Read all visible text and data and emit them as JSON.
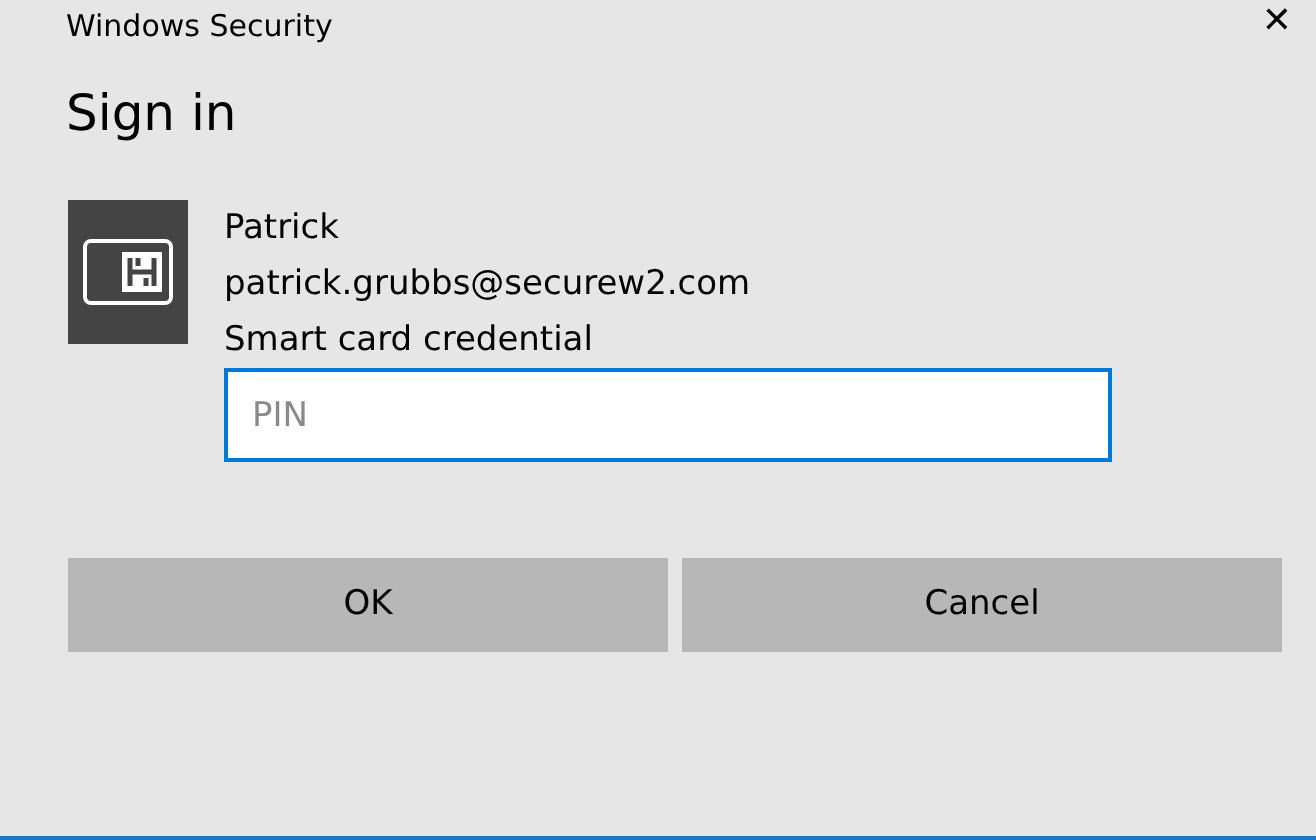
{
  "window": {
    "title": "Windows Security",
    "close": "✕"
  },
  "heading": "Sign in",
  "account": {
    "name": "Patrick",
    "email": "patrick.grubbs@securew2.com",
    "credential": "Smart card credential"
  },
  "pin_field": {
    "placeholder": "PIN",
    "focused": true
  },
  "buttons": [
    "OK",
    "Cancel"
  ]
}
